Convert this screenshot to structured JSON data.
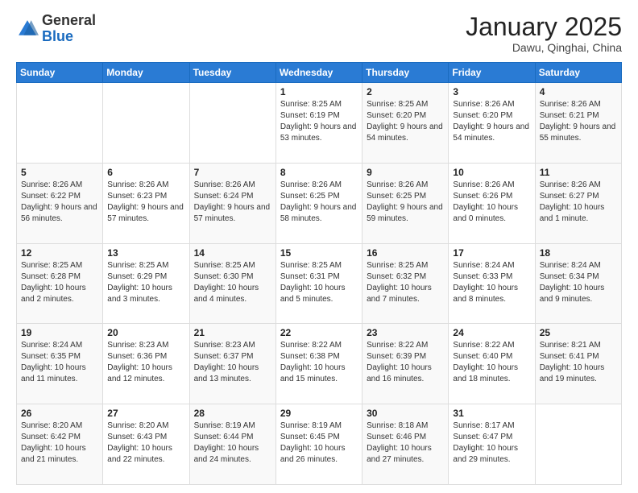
{
  "header": {
    "logo": {
      "general": "General",
      "blue": "Blue"
    },
    "title": "January 2025",
    "subtitle": "Dawu, Qinghai, China"
  },
  "weekdays": [
    "Sunday",
    "Monday",
    "Tuesday",
    "Wednesday",
    "Thursday",
    "Friday",
    "Saturday"
  ],
  "weeks": [
    [
      {
        "day": "",
        "info": ""
      },
      {
        "day": "",
        "info": ""
      },
      {
        "day": "",
        "info": ""
      },
      {
        "day": "1",
        "info": "Sunrise: 8:25 AM\nSunset: 6:19 PM\nDaylight: 9 hours and 53 minutes."
      },
      {
        "day": "2",
        "info": "Sunrise: 8:25 AM\nSunset: 6:20 PM\nDaylight: 9 hours and 54 minutes."
      },
      {
        "day": "3",
        "info": "Sunrise: 8:26 AM\nSunset: 6:20 PM\nDaylight: 9 hours and 54 minutes."
      },
      {
        "day": "4",
        "info": "Sunrise: 8:26 AM\nSunset: 6:21 PM\nDaylight: 9 hours and 55 minutes."
      }
    ],
    [
      {
        "day": "5",
        "info": "Sunrise: 8:26 AM\nSunset: 6:22 PM\nDaylight: 9 hours and 56 minutes."
      },
      {
        "day": "6",
        "info": "Sunrise: 8:26 AM\nSunset: 6:23 PM\nDaylight: 9 hours and 57 minutes."
      },
      {
        "day": "7",
        "info": "Sunrise: 8:26 AM\nSunset: 6:24 PM\nDaylight: 9 hours and 57 minutes."
      },
      {
        "day": "8",
        "info": "Sunrise: 8:26 AM\nSunset: 6:25 PM\nDaylight: 9 hours and 58 minutes."
      },
      {
        "day": "9",
        "info": "Sunrise: 8:26 AM\nSunset: 6:25 PM\nDaylight: 9 hours and 59 minutes."
      },
      {
        "day": "10",
        "info": "Sunrise: 8:26 AM\nSunset: 6:26 PM\nDaylight: 10 hours and 0 minutes."
      },
      {
        "day": "11",
        "info": "Sunrise: 8:26 AM\nSunset: 6:27 PM\nDaylight: 10 hours and 1 minute."
      }
    ],
    [
      {
        "day": "12",
        "info": "Sunrise: 8:25 AM\nSunset: 6:28 PM\nDaylight: 10 hours and 2 minutes."
      },
      {
        "day": "13",
        "info": "Sunrise: 8:25 AM\nSunset: 6:29 PM\nDaylight: 10 hours and 3 minutes."
      },
      {
        "day": "14",
        "info": "Sunrise: 8:25 AM\nSunset: 6:30 PM\nDaylight: 10 hours and 4 minutes."
      },
      {
        "day": "15",
        "info": "Sunrise: 8:25 AM\nSunset: 6:31 PM\nDaylight: 10 hours and 5 minutes."
      },
      {
        "day": "16",
        "info": "Sunrise: 8:25 AM\nSunset: 6:32 PM\nDaylight: 10 hours and 7 minutes."
      },
      {
        "day": "17",
        "info": "Sunrise: 8:24 AM\nSunset: 6:33 PM\nDaylight: 10 hours and 8 minutes."
      },
      {
        "day": "18",
        "info": "Sunrise: 8:24 AM\nSunset: 6:34 PM\nDaylight: 10 hours and 9 minutes."
      }
    ],
    [
      {
        "day": "19",
        "info": "Sunrise: 8:24 AM\nSunset: 6:35 PM\nDaylight: 10 hours and 11 minutes."
      },
      {
        "day": "20",
        "info": "Sunrise: 8:23 AM\nSunset: 6:36 PM\nDaylight: 10 hours and 12 minutes."
      },
      {
        "day": "21",
        "info": "Sunrise: 8:23 AM\nSunset: 6:37 PM\nDaylight: 10 hours and 13 minutes."
      },
      {
        "day": "22",
        "info": "Sunrise: 8:22 AM\nSunset: 6:38 PM\nDaylight: 10 hours and 15 minutes."
      },
      {
        "day": "23",
        "info": "Sunrise: 8:22 AM\nSunset: 6:39 PM\nDaylight: 10 hours and 16 minutes."
      },
      {
        "day": "24",
        "info": "Sunrise: 8:22 AM\nSunset: 6:40 PM\nDaylight: 10 hours and 18 minutes."
      },
      {
        "day": "25",
        "info": "Sunrise: 8:21 AM\nSunset: 6:41 PM\nDaylight: 10 hours and 19 minutes."
      }
    ],
    [
      {
        "day": "26",
        "info": "Sunrise: 8:20 AM\nSunset: 6:42 PM\nDaylight: 10 hours and 21 minutes."
      },
      {
        "day": "27",
        "info": "Sunrise: 8:20 AM\nSunset: 6:43 PM\nDaylight: 10 hours and 22 minutes."
      },
      {
        "day": "28",
        "info": "Sunrise: 8:19 AM\nSunset: 6:44 PM\nDaylight: 10 hours and 24 minutes."
      },
      {
        "day": "29",
        "info": "Sunrise: 8:19 AM\nSunset: 6:45 PM\nDaylight: 10 hours and 26 minutes."
      },
      {
        "day": "30",
        "info": "Sunrise: 8:18 AM\nSunset: 6:46 PM\nDaylight: 10 hours and 27 minutes."
      },
      {
        "day": "31",
        "info": "Sunrise: 8:17 AM\nSunset: 6:47 PM\nDaylight: 10 hours and 29 minutes."
      },
      {
        "day": "",
        "info": ""
      }
    ]
  ]
}
